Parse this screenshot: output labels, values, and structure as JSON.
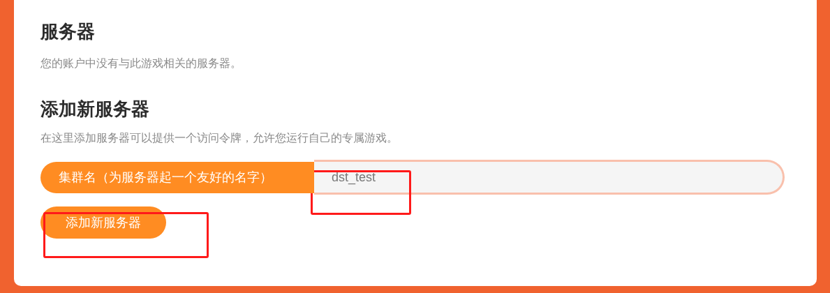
{
  "servers": {
    "title": "服务器",
    "message": "您的账户中没有与此游戏相关的服务器。"
  },
  "add_server": {
    "title": "添加新服务器",
    "description": "在这里添加服务器可以提供一个访问令牌，允许您运行自己的专属游戏。",
    "cluster_name": {
      "label": "集群名（为服务器起一个友好的名字）",
      "value": "dst_test"
    },
    "button": "添加新服务器"
  }
}
